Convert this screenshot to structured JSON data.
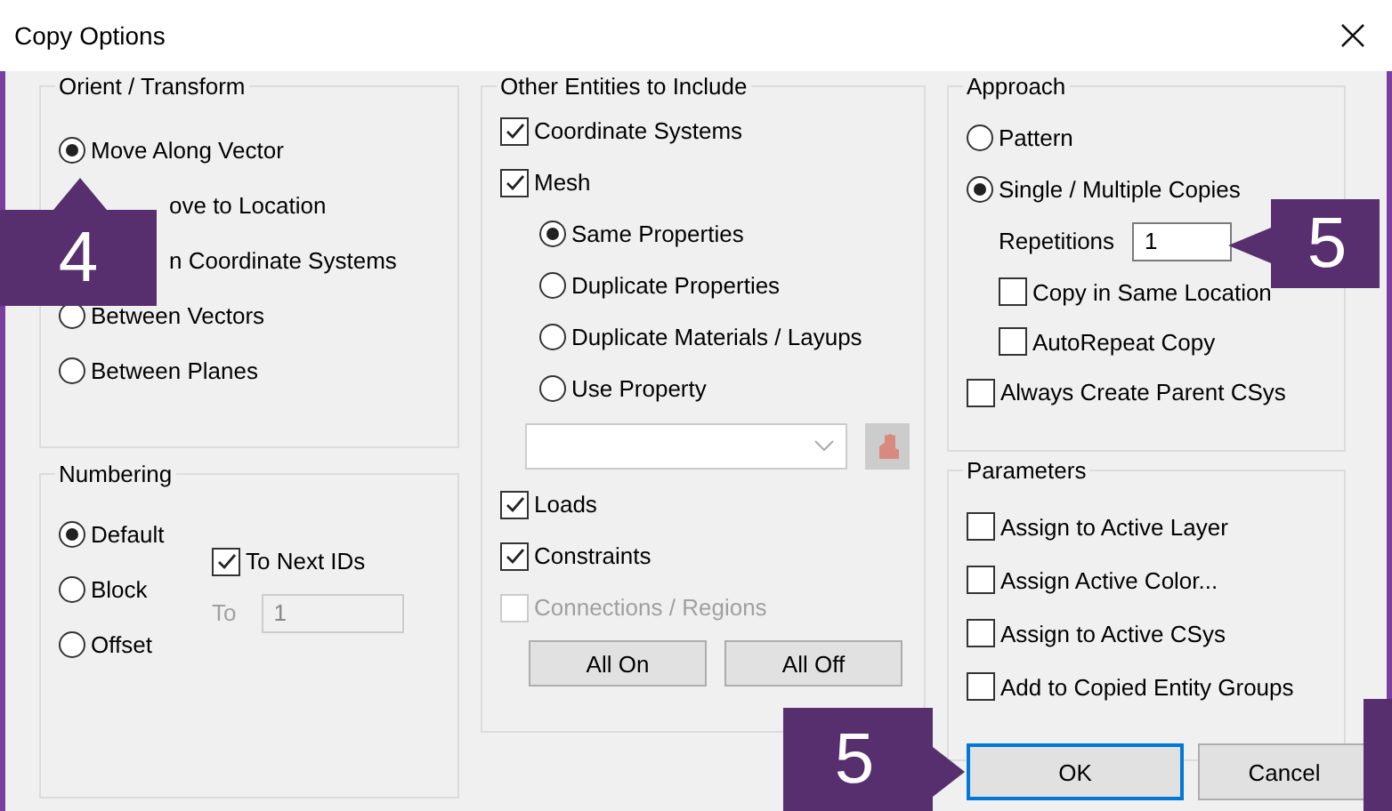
{
  "window": {
    "title": "Copy Options"
  },
  "orient_transform": {
    "title": "Orient / Transform",
    "options": [
      {
        "kind": "radio",
        "label": "Move Along Vector",
        "selected": true
      },
      {
        "kind": "obscured",
        "label": "ove to Location"
      },
      {
        "kind": "obscured",
        "label": "n Coordinate Systems"
      },
      {
        "kind": "radio",
        "label": "Between Vectors",
        "selected": false
      },
      {
        "kind": "radio",
        "label": "Between Planes",
        "selected": false
      }
    ]
  },
  "numbering": {
    "title": "Numbering",
    "options": [
      {
        "label": "Default",
        "selected": true
      },
      {
        "label": "Block",
        "selected": false
      },
      {
        "label": "Offset",
        "selected": false
      }
    ],
    "to_next_ids": {
      "label": "To Next IDs",
      "checked": true
    },
    "to_field": {
      "label": "To",
      "value": "1",
      "disabled": true
    }
  },
  "other_entities": {
    "title": "Other Entities to Include",
    "items": [
      {
        "kind": "checkbox",
        "label": "Coordinate Systems",
        "checked": true,
        "disabled": false
      },
      {
        "kind": "checkbox",
        "label": "Mesh",
        "checked": true,
        "disabled": false
      },
      {
        "kind": "radio",
        "label": "Same Properties",
        "selected": true
      },
      {
        "kind": "radio",
        "label": "Duplicate Properties",
        "selected": false
      },
      {
        "kind": "radio",
        "label": "Duplicate Materials / Layups",
        "selected": false
      },
      {
        "kind": "radio",
        "label": "Use Property",
        "selected": false
      },
      {
        "kind": "property_select",
        "disabled": true
      },
      {
        "kind": "checkbox",
        "label": "Loads",
        "checked": true,
        "disabled": false
      },
      {
        "kind": "checkbox",
        "label": "Constraints",
        "checked": true,
        "disabled": false
      },
      {
        "kind": "checkbox",
        "label": "Connections / Regions",
        "checked": false,
        "disabled": true
      }
    ],
    "buttons": [
      "All On",
      "All Off"
    ]
  },
  "approach": {
    "title": "Approach",
    "options": [
      {
        "label": "Pattern",
        "selected": false
      },
      {
        "label": "Single / Multiple Copies",
        "selected": true
      }
    ],
    "repetitions": {
      "label": "Repetitions",
      "value": "1"
    },
    "sub_options": [
      {
        "label": "Copy in Same Location",
        "checked": false
      },
      {
        "label": "AutoRepeat Copy",
        "checked": false
      }
    ],
    "always_create_parent": {
      "label": "Always Create Parent CSys",
      "checked": false
    }
  },
  "parameters": {
    "title": "Parameters",
    "items": [
      {
        "label": "Assign to Active Layer",
        "checked": false
      },
      {
        "label": "Assign Active Color...",
        "checked": false
      },
      {
        "label": "Assign to Active CSys",
        "checked": false
      },
      {
        "label": "Add to Copied Entity Groups",
        "checked": false
      }
    ]
  },
  "buttons": [
    {
      "label": "OK",
      "default": true
    },
    {
      "label": "Cancel",
      "default": false
    }
  ],
  "callouts": [
    {
      "kind": "up",
      "label": "4"
    },
    {
      "kind": "left",
      "label": "5"
    },
    {
      "kind": "right",
      "label": "5"
    },
    {
      "kind": "edge"
    }
  ]
}
